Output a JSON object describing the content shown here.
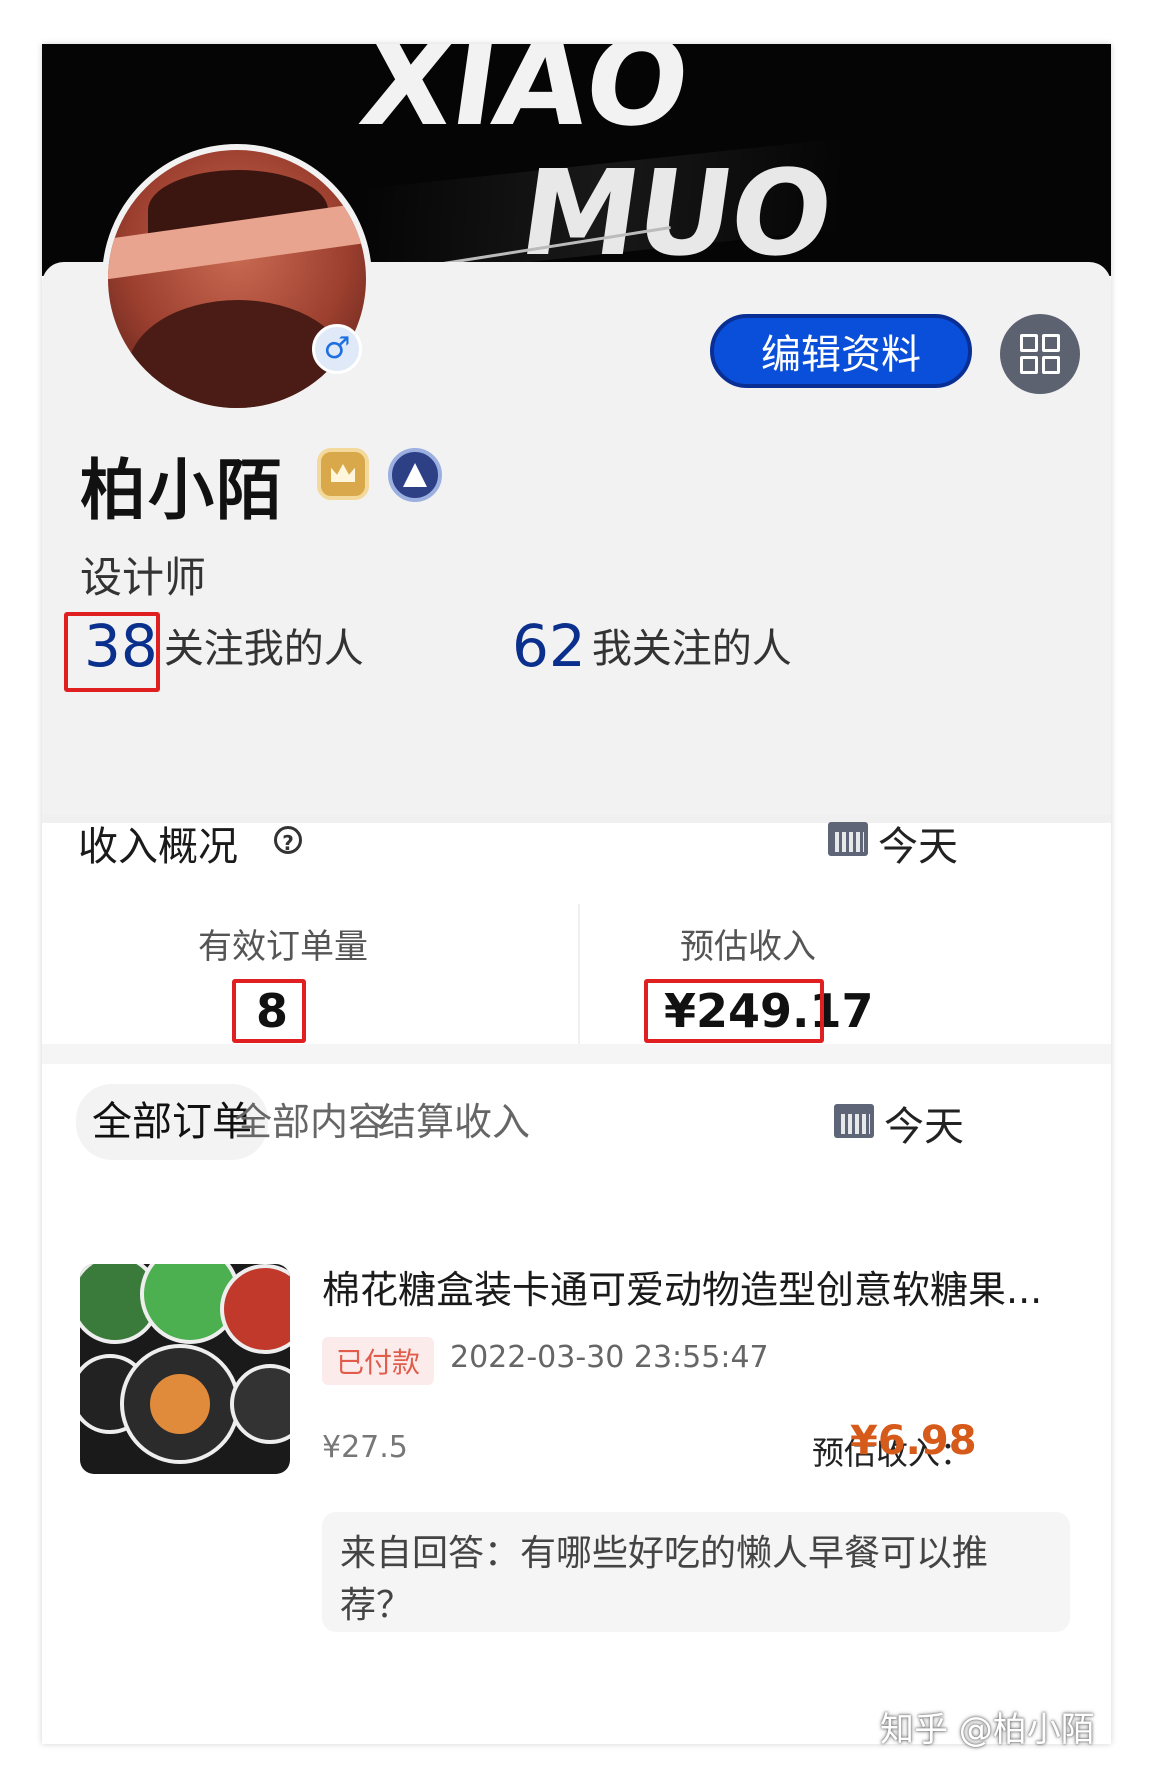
{
  "banner": {
    "line1": "XIAO",
    "line2": "MUO"
  },
  "profile": {
    "gender_symbol": "♂",
    "edit_button": "编辑资料",
    "name": "柏小陌",
    "title": "设计师",
    "followers": {
      "count": "38",
      "label": "关注我的人"
    },
    "following": {
      "count": "62",
      "label": "我关注的人"
    }
  },
  "income": {
    "title": "收入概况",
    "help_symbol": "?",
    "period": "今天",
    "orders_label": "有效订单量",
    "orders_value": "8",
    "estimated_label": "预估收入",
    "estimated_value": "¥249.17"
  },
  "orders": {
    "tabs": [
      "全部订单",
      "全部内容",
      "结算收入"
    ],
    "period": "今天",
    "item": {
      "title": "棉花糖盒装卡通可爱动物造型创意软糖果...",
      "status": "已付款",
      "date": "2022-03-30 23:55:47",
      "price": "¥27.5",
      "estimated_label": "预估收入：",
      "estimated_value": "¥6.98",
      "source": "来自回答：有哪些好吃的懒人早餐可以推荐？"
    }
  },
  "watermark": "知乎 @柏小陌",
  "colors": {
    "accent_blue": "#0a4fd9",
    "highlight_red": "#e02020",
    "earnings_orange": "#d65a1a"
  }
}
